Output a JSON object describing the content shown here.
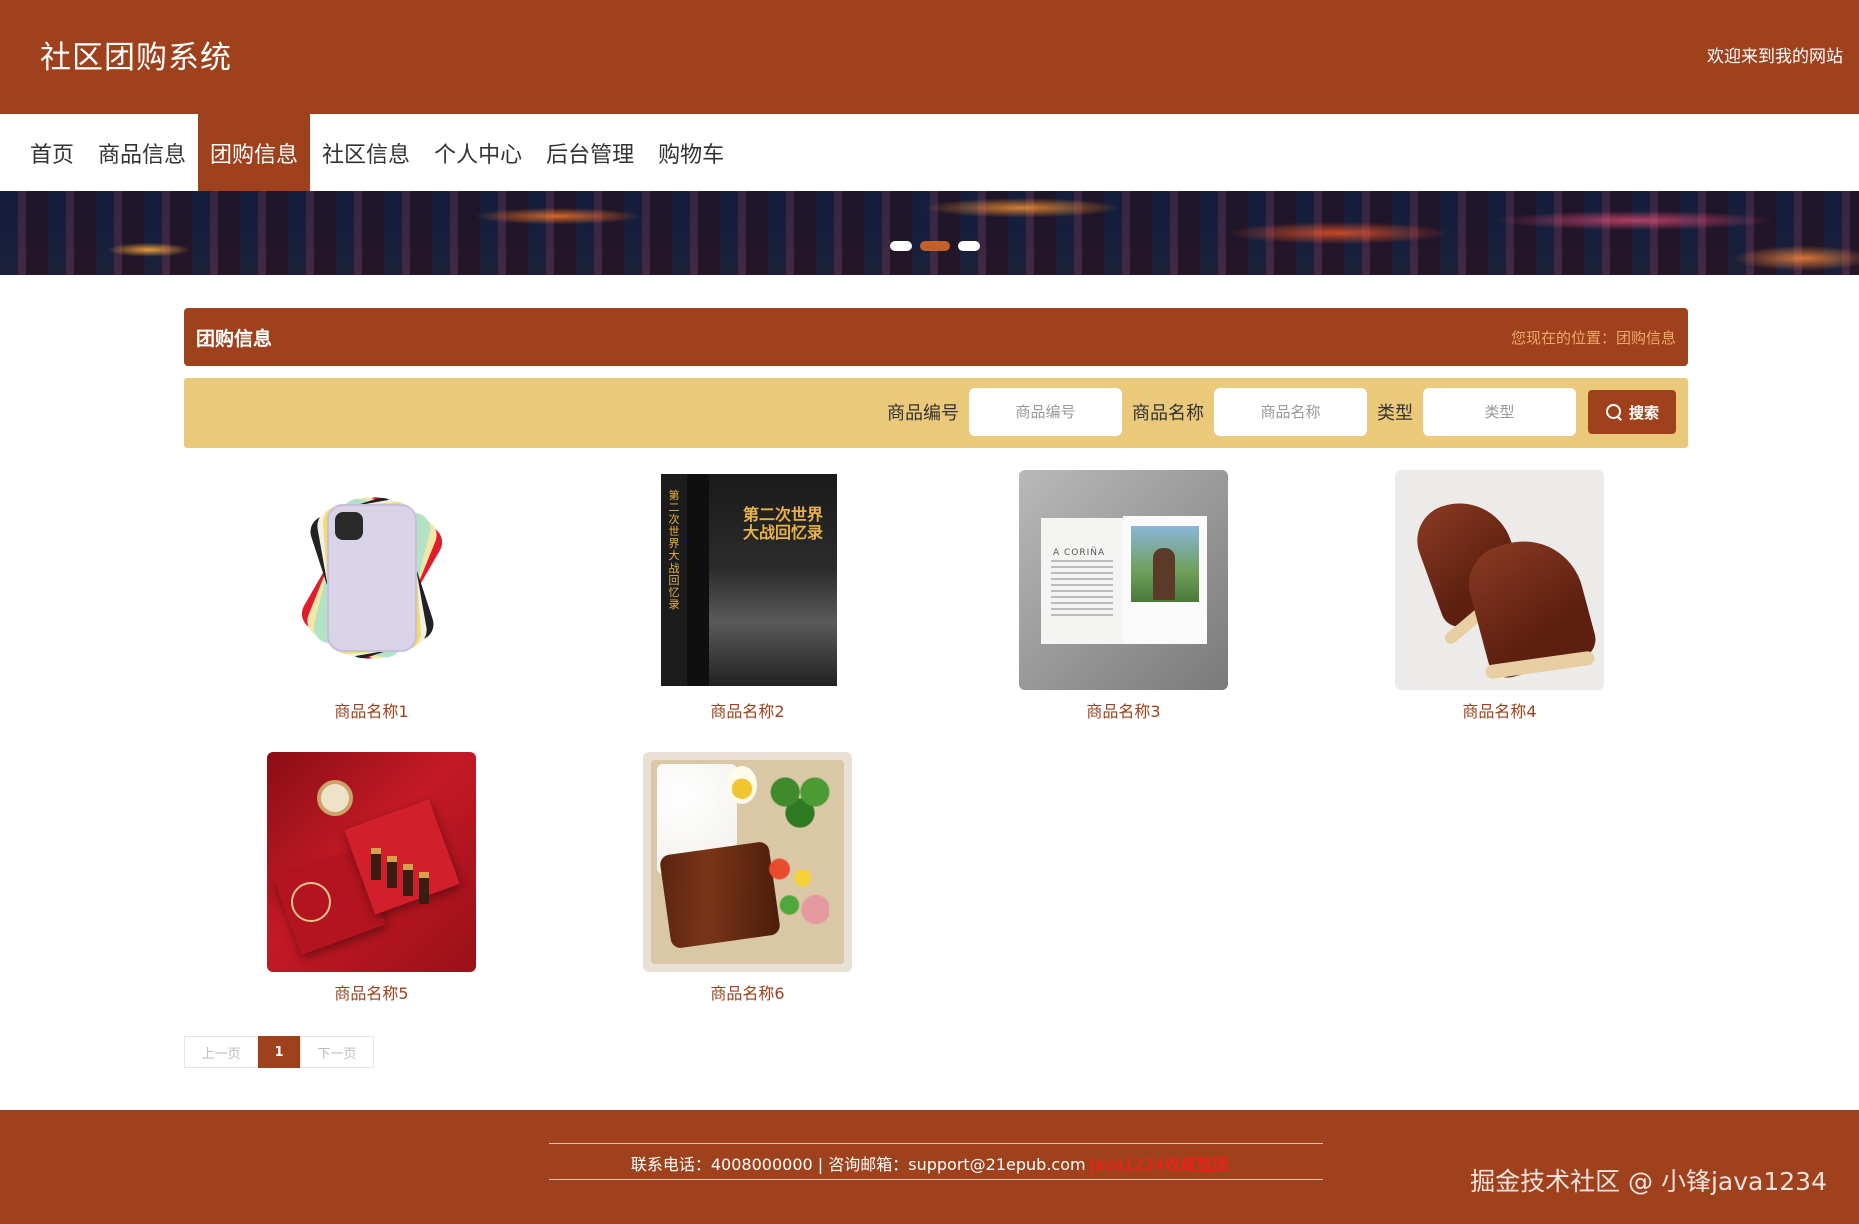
{
  "header": {
    "site_title": "社区团购系统",
    "welcome": "欢迎来到我的网站"
  },
  "nav": {
    "items": [
      {
        "label": "首页",
        "active": false
      },
      {
        "label": "商品信息",
        "active": false
      },
      {
        "label": "团购信息",
        "active": true
      },
      {
        "label": "社区信息",
        "active": false
      },
      {
        "label": "个人中心",
        "active": false
      },
      {
        "label": "后台管理",
        "active": false
      },
      {
        "label": "购物车",
        "active": false
      }
    ]
  },
  "banner": {
    "slide_count": 3,
    "active_slide": 2
  },
  "section": {
    "title": "团购信息",
    "breadcrumb": "您现在的位置：团购信息"
  },
  "search": {
    "fields": [
      {
        "label": "商品编号",
        "placeholder": "商品编号",
        "value": ""
      },
      {
        "label": "商品名称",
        "placeholder": "商品名称",
        "value": ""
      },
      {
        "label": "类型",
        "placeholder": "类型",
        "value": ""
      }
    ],
    "button_label": "搜索",
    "button_icon": "search-icon"
  },
  "products": [
    {
      "name": "商品名称1",
      "image": "phone-image"
    },
    {
      "name": "商品名称2",
      "image": "book-image"
    },
    {
      "name": "商品名称3",
      "image": "magazine-image"
    },
    {
      "name": "商品名称4",
      "image": "shoes-image"
    },
    {
      "name": "商品名称5",
      "image": "gift-box-image"
    },
    {
      "name": "商品名称6",
      "image": "bento-image"
    }
  ],
  "product_image_text": {
    "book_cover": "第二次世界大战回忆录",
    "book_spine": "第二次世界大战回忆录",
    "magazine_title": "A CORIÑA"
  },
  "pagination": {
    "prev": "上一页",
    "current": "1",
    "next": "下一页"
  },
  "footer": {
    "contact": "联系电话：4008000000 | 咨询邮箱：support@21epub.com",
    "credit": "Java1234收藏整理",
    "watermark": "掘金技术社区 @ 小锋java1234"
  },
  "colors": {
    "brand": "#9e411c",
    "search_bar": "#ebc97a",
    "breadcrumb": "#f0a96a",
    "credit": "#ff1a1a"
  }
}
